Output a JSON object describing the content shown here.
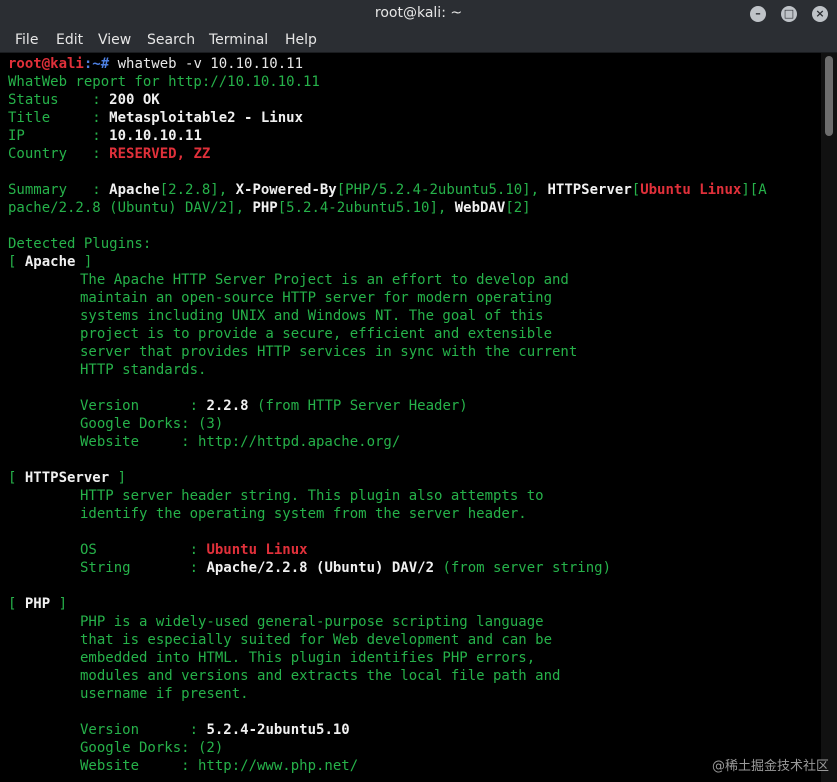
{
  "window": {
    "title": "root@kali: ~",
    "buttons": [
      "minimize-icon",
      "maximize-icon",
      "close-icon"
    ]
  },
  "menu": [
    "File",
    "Edit",
    "View",
    "Search",
    "Terminal",
    "Help"
  ],
  "prompt": {
    "user": "root@kali",
    "path": ":~#",
    "command": " whatweb -v 10.10.10.11"
  },
  "report": {
    "header": "WhatWeb report for http://10.10.10.11",
    "status_label": "Status    : ",
    "status": "200 OK",
    "title_label": "Title     : ",
    "title": "Metasploitable2 - Linux",
    "ip_label": "IP        : ",
    "ip": "10.10.10.11",
    "country_label": "Country   : ",
    "country": "RESERVED, ZZ"
  },
  "summary": {
    "label": "Summary   : ",
    "p1": "Apache",
    "v1": "[2.2.8], ",
    "p2": "X-Powered-By",
    "v2": "[PHP/5.2.4-2ubuntu5.10], ",
    "p3": "HTTPServer",
    "v3a": "[",
    "v3b": "Ubuntu Linux",
    "v3c": "][A",
    "line2a": "pache/2.2.8 (Ubuntu) DAV/2], ",
    "p4": "PHP",
    "v4": "[5.2.4-2ubuntu5.10], ",
    "p5": "WebDAV",
    "v5": "[2]"
  },
  "detected": "Detected Plugins:",
  "apache": {
    "open": "[ ",
    "name": "Apache",
    "close": " ]",
    "desc": [
      "The Apache HTTP Server Project is an effort to develop and",
      "maintain an open-source HTTP server for modern operating",
      "systems including UNIX and Windows NT. The goal of this",
      "project is to provide a secure, efficient and extensible",
      "server that provides HTTP services in sync with the current",
      "HTTP standards."
    ],
    "version_label": "Version      : ",
    "version": "2.2.8",
    "version_src": " (from HTTP Server Header)",
    "dorks": "Google Dorks: (3)",
    "website": "Website     : http://httpd.apache.org/"
  },
  "httpserver": {
    "open": "[ ",
    "name": "HTTPServer",
    "close": " ]",
    "desc": [
      "HTTP server header string. This plugin also attempts to",
      "identify the operating system from the server header."
    ],
    "os_label": "OS           : ",
    "os": "Ubuntu Linux",
    "string_label": "String       : ",
    "string": "Apache/2.2.8 (Ubuntu) DAV/2",
    "string_src": " (from server string)"
  },
  "php": {
    "open": "[ ",
    "name": "PHP",
    "close": " ]",
    "desc": [
      "PHP is a widely-used general-purpose scripting language",
      "that is especially suited for Web development and can be",
      "embedded into HTML. This plugin identifies PHP errors,",
      "modules and versions and extracts the local file path and",
      "username if present."
    ],
    "version_label": "Version      : ",
    "version": "5.2.4-2ubuntu5.10",
    "dorks": "Google Dorks: (2)",
    "website": "Website     : http://www.php.net/"
  },
  "watermark": "@稀土掘金技术社区",
  "colors": {
    "green": "#26b24a",
    "red": "#e0303a",
    "blue": "#4d7fe0",
    "titlebar": "#2b2e33"
  }
}
